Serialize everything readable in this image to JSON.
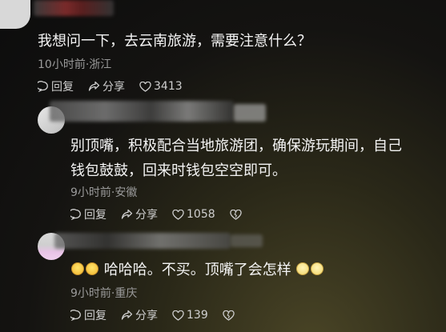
{
  "comment1": {
    "text": "我想问一下，去云南旅游，需要注意什么？",
    "meta": "10小时前·浙江",
    "reply_label": "回复",
    "share_label": "分享",
    "likes": "3413"
  },
  "comment2": {
    "line1": "别顶嘴，积极配合当地旅游团，确保游玩期间，自己",
    "line2": "钱包鼓鼓，回来时钱包空空即可。",
    "meta": "9小时前·安徽",
    "reply_label": "回复",
    "share_label": "分享",
    "likes": "1058"
  },
  "comment3": {
    "text_main": "哈哈哈。不买。顶嘴了会怎样",
    "meta": "9小时前·重庆",
    "reply_label": "回复",
    "share_label": "分享",
    "likes": "139"
  }
}
